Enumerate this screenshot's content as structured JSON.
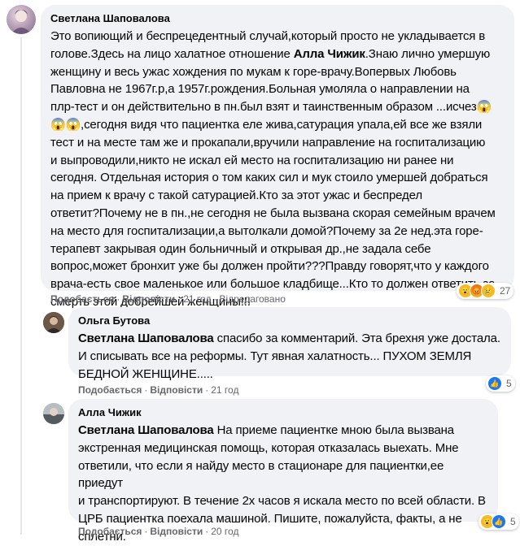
{
  "comments": [
    {
      "author": "Светлана Шаповалова",
      "lines": [
        "Это вопиющий и беспрецедентный случай,который просто не укладывается в",
        "голове.Здесь на лицо халатное отношение ",
        "женщину и весь ужас хождения по мукам к горе-врачу.Вопервых Любовь",
        "Павловна не 1967г.р,а 1957г.рождения.Больная умоляла о направлении на",
        "плр-тест и он действительно в пн.был взят и таинственным образом ...исчез😱",
        "😱😱,сегодня видя что пациентка еле жива,сатурация упала,ей все же взяли",
        "тест и на месте там же и прокапали,вручили направление на госпитализацию",
        "и выпроводили,никто не искал ей место на госпитализацию ни ранее ни",
        "сегодня. Отдельная история о том каких сил и мук стоило умершей добраться",
        "на прием к врачу с такой сатурацией.Кто за этот ужас и беспредел",
        "ответит?Почему не в пн.,не сегодня не была вызвана скорая семейным врачем",
        "на место для госпитализации,а вытолкали домой?Почему за 2е нед.эта горе-",
        "терапевт закрывая один больничный и открывая др.,не задала себе",
        "вопрос,может бронхит уже бы должен пройти???Правду говорят,что у каждого",
        "врача-есть свое маленькое или большое кладбище...Кто то должен ответить за",
        "смерть этой добрейшей женщины!!!"
      ],
      "mention": "Алла Чижик",
      "mention_after": ".Знаю лично умершую",
      "like_label": "Подобається",
      "reply_label": "Відповісти",
      "time": "21 год",
      "edited": "Відредаговано",
      "reaction_count": "27",
      "reactions": [
        "wow",
        "angry",
        "sad"
      ]
    },
    {
      "author": "Ольга Бутова",
      "mention": "Светлана Шаповалова",
      "lines": [
        " спасибо за комментарий. Эта брехня уже достала.",
        "И списывать все на реформы. Тут явная халатность... ПУХОМ ЗЕМЛЯ",
        "БЕДНОЙ ЖЕНЩИНЕ....."
      ],
      "like_label": "Подобається",
      "reply_label": "Відповісти",
      "time": "21 год",
      "reaction_count": "5",
      "reactions": [
        "like"
      ]
    },
    {
      "author": "Алла Чижик",
      "mention": "Светлана Шаповалова",
      "lines": [
        " На приеме пациентке мною была вызвана",
        "экстренная медицинская помощь, которая отказалась выехать. Мне",
        "ответили, что если я найду место в стационаре для пациентки,ее приедут",
        "и транспортируют. В течение 2х часов я искала место по всей области. В",
        "ЦРБ пациентка поехала машиной. Пишите, пожалуйста, факты, а не",
        "сплетни."
      ],
      "like_label": "Подобається",
      "reply_label": "Відповісти",
      "time": "20 год",
      "reaction_count": "5",
      "reactions": [
        "wow",
        "like"
      ]
    }
  ],
  "icons": {
    "like": "👍",
    "angry": "😡",
    "sad": "😢",
    "wow": "😮"
  },
  "colors": {
    "bubble": "#f0f2f5",
    "secondary_text": "#65676b",
    "like_blue": "#1877f2"
  }
}
